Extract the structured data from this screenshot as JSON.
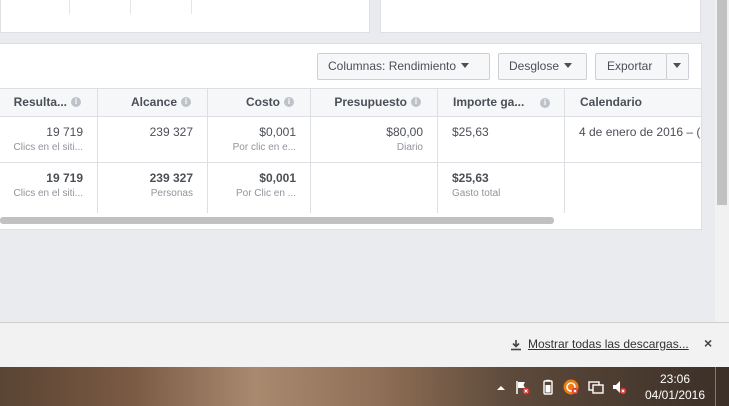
{
  "toolbar": {
    "columns_label": "Columnas: Rendimiento",
    "breakdown_label": "Desglose",
    "export_label": "Exportar"
  },
  "table": {
    "headers": {
      "results": "Resulta...",
      "reach": "Alcance",
      "cost": "Costo",
      "budget": "Presupuesto",
      "amount": "Importe ga...",
      "schedule": "Calendario"
    },
    "row1": {
      "results": "19 719",
      "results_sub": "Clics en el siti...",
      "reach": "239 327",
      "cost": "$0,001",
      "cost_sub": "Por clic en e...",
      "budget": "$80,00",
      "budget_sub": "Diario",
      "amount": "$25,63",
      "schedule": "4 de enero de 2016 – ("
    },
    "totals": {
      "results": "19 719",
      "results_sub": "Clics en el siti...",
      "reach": "239 327",
      "reach_sub": "Personas",
      "cost": "$0,001",
      "cost_sub": "Por Clic en ...",
      "amount": "$25,63",
      "amount_sub": "Gasto total"
    }
  },
  "downloads": {
    "show_all_label": "Mostrar todas las descargas...",
    "close_label": "×"
  },
  "taskbar": {
    "time": "23:06",
    "date": "04/01/2016"
  },
  "colors": {
    "accent": "#4b4f56",
    "muted": "#90949c",
    "border": "#dddfe2"
  },
  "icons": [
    "info-icon",
    "download-icon",
    "close-icon",
    "caret-down-icon",
    "tray-arrow-icon",
    "flag-icon",
    "battery-icon",
    "avast-icon",
    "network-icon",
    "volume-mute-icon"
  ]
}
